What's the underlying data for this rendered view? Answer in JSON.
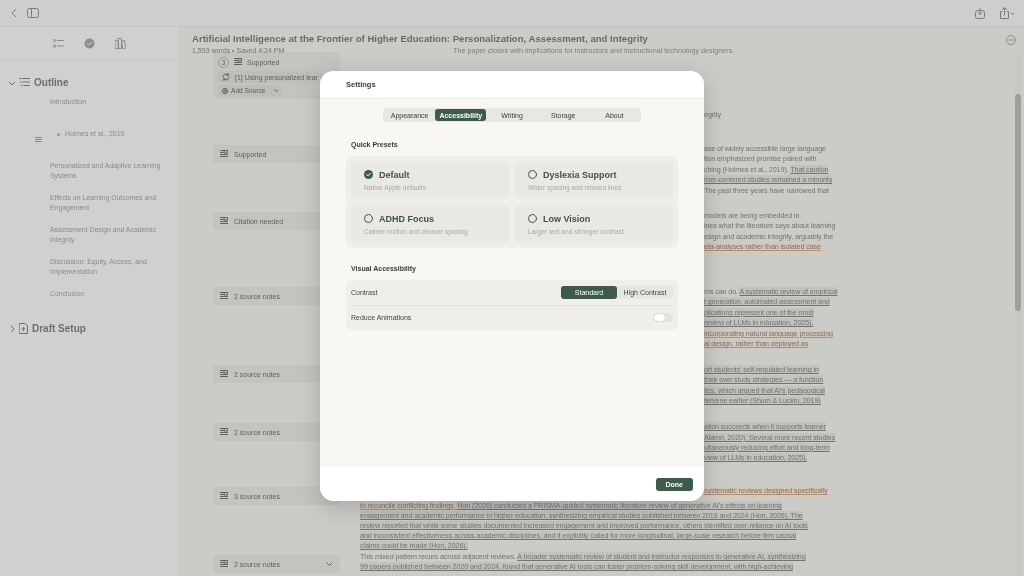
{
  "sidebar": {
    "sections": [
      {
        "title": "Outline",
        "expanded": true,
        "items": [
          {
            "label": "Introduction",
            "children": [
              {
                "label": "Holmes et al., 2019"
              }
            ]
          },
          {
            "label": "Personalized and Adaptive Learning Systems"
          },
          {
            "label": "Effects on Learning Outcomes and Engagement"
          },
          {
            "label": "Assessment Design and Academic Integrity"
          },
          {
            "label": "Discussion: Equity, Access, and Implementation"
          },
          {
            "label": "Conclusion"
          }
        ]
      },
      {
        "title": "Draft Setup",
        "expanded": false
      }
    ]
  },
  "document": {
    "title": "Artificial Intelligence at the Frontier of Higher Education: Personalization, Assessment, and Integrity",
    "meta": "1,553 words • Saved 4:24 PM",
    "lead": "The paper closes with implications for instructors and instructional technology designers.",
    "annotations": [
      {
        "kind": "expanded",
        "number": "3",
        "label": "Supported",
        "source": "[1] Using personalized lear",
        "action": "Add Source"
      },
      {
        "kind": "collapsed",
        "label": "Supported"
      },
      {
        "kind": "collapsed",
        "label": "Citation needed"
      },
      {
        "kind": "collapsed",
        "label": "2 source notes"
      },
      {
        "kind": "collapsed",
        "label": "2 source notes"
      },
      {
        "kind": "collapsed",
        "label": "2 source notes"
      },
      {
        "kind": "collapsed",
        "label": "3 source notes"
      },
      {
        "kind": "dropdown",
        "label": "2 source notes"
      }
    ],
    "text_right_of_dialog": [
      {
        "lines": [
          [
            {
              "text": "egrity",
              "kind": "plain"
            }
          ]
        ]
      },
      {
        "lines": [
          [
            {
              "text": "ase of widely accessible large language",
              "kind": "plain"
            }
          ],
          [
            {
              "text": "tion emphasized promise paired with",
              "kind": "plain"
            }
          ],
          [
            {
              "text": "ching (Holmes et al., 2019). ",
              "kind": "plain"
            },
            {
              "text": "That caution",
              "kind": "cited"
            }
          ],
          [
            {
              "text": "rner-centered studies remained a minority",
              "kind": "cited"
            }
          ],
          [
            {
              "text": "The past three years have narrowed that",
              "kind": "plain"
            }
          ],
          [
            {
              "text": ".",
              "kind": "plain"
            }
          ]
        ]
      },
      {
        "lines": [
          [
            {
              "text": "models are being embedded in",
              "kind": "plain"
            }
          ],
          [
            {
              "text": "ines what the literature says about learning",
              "kind": "plain"
            }
          ],
          [
            {
              "text": "esign and academic integrity, arguably the",
              "kind": "plain"
            }
          ],
          [
            {
              "text": "eta-analyses rather than isolated case",
              "kind": "flagged"
            }
          ]
        ]
      },
      {
        "lines": [
          [
            {
              "text": "ms can do. ",
              "kind": "plain"
            },
            {
              "text": "A systematic review of empirical",
              "kind": "cited"
            }
          ],
          [
            {
              "text": "t generation, automated assessment and",
              "kind": "cited"
            }
          ],
          [
            {
              "text": "plications represent one of the most",
              "kind": "cited"
            }
          ],
          [
            {
              "text": "review of LLMs in education, 2025).",
              "kind": "cited"
            }
          ],
          [
            {
              "text": "incorporating natural language processing",
              "kind": "flagged"
            }
          ],
          [
            {
              "text": "al design, rather than deployed as",
              "kind": "flagged"
            }
          ]
        ]
      },
      {
        "lines": [
          [
            {
              "text": "ort students' self-regulated learning in",
              "kind": "cited"
            }
          ],
          [
            {
              "text": "their own study strategies — a function",
              "kind": "cited"
            }
          ],
          [
            {
              "text": "tics, which argued that AI's pedagogical",
              "kind": "cited"
            }
          ],
          [
            {
              "text": "tervene earlier (Shum & Luckin, 2019)",
              "kind": "cited"
            }
          ]
        ]
      },
      {
        "lines": [
          [
            {
              "text": "ation succeeds when it supports learner",
              "kind": "cited"
            }
          ],
          [
            {
              "text": "Alamri, 2020). ",
              "kind": "cited"
            },
            {
              "text": "Several more recent studies",
              "kind": "cited"
            }
          ],
          [
            {
              "text": "ultaneously reducing effort and long-term",
              "kind": "cited"
            }
          ],
          [
            {
              "text": "view of LLMs in education, 2025).",
              "kind": "cited"
            }
          ]
        ]
      },
      {
        "lines": [
          [
            {
              "text": "systematic reviews designed specifically",
              "kind": "flagged"
            }
          ]
        ]
      }
    ],
    "text_below_dialog": [
      {
        "lines": [
          [
            {
              "text": "to reconcile conflicting findings. ",
              "kind": "flagged"
            },
            {
              "text": "Hon (2026) conducted a PRISMA-guided systematic literature review of generative AI's effects on learning",
              "kind": "cited"
            }
          ],
          [
            {
              "text": "engagement and academic performance in higher education, synthesizing empirical studies published between 2018 and 2024 (Hon, 2026). The",
              "kind": "cited"
            }
          ],
          [
            {
              "text": "review reported that while some studies documented increased engagement and improved performance, others identified over-reliance on AI tools",
              "kind": "cited"
            }
          ],
          [
            {
              "text": "and inconsistent effectiveness across academic disciplines, and it explicitly called for more longitudinal, large-scale research before firm causal",
              "kind": "cited"
            }
          ],
          [
            {
              "text": "claims could be made (Hon, 2026).",
              "kind": "cited"
            }
          ]
        ]
      },
      {
        "lines": [
          [
            {
              "text": "This mixed pattern recurs across adjacent reviews. ",
              "kind": "plain"
            },
            {
              "text": "A broader systematic review of student and instructor responses to generative AI, synthesizing",
              "kind": "cited"
            }
          ],
          [
            {
              "text": "99 papers published between 2020 and 2024, found that generative AI tools can foster problem-solving skill development, with high-achieving",
              "kind": "cited"
            }
          ]
        ]
      }
    ]
  },
  "settings": {
    "title": "Settings",
    "tabs": [
      {
        "label": "Appearance",
        "selected": false
      },
      {
        "label": "Accessibility",
        "selected": true
      },
      {
        "label": "Writing",
        "selected": false
      },
      {
        "label": "Storage",
        "selected": false
      },
      {
        "label": "About",
        "selected": false
      }
    ],
    "presets_title": "Quick Presets",
    "presets": [
      {
        "name": "Default",
        "description": "Native Apple defaults",
        "selected": true
      },
      {
        "name": "Dyslexia Support",
        "description": "Wider spacing and relaxed lines",
        "selected": false
      },
      {
        "name": "ADHD Focus",
        "description": "Calmer motion and cleaner spacing",
        "selected": false
      },
      {
        "name": "Low Vision",
        "description": "Larger text and stronger contrast",
        "selected": false
      }
    ],
    "visual_title": "Visual Accessibility",
    "rows": [
      {
        "kind": "segmented",
        "label": "Contrast",
        "options": [
          {
            "label": "Standard",
            "selected": true
          },
          {
            "label": "High Contrast",
            "selected": false
          }
        ]
      },
      {
        "kind": "toggle",
        "label": "Reduce Animations",
        "on": false
      }
    ],
    "done": "Done"
  }
}
